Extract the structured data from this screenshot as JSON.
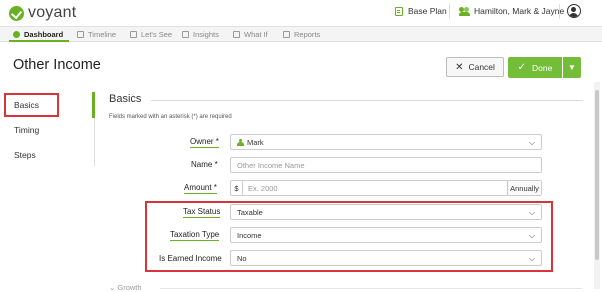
{
  "app": {
    "brand": "voyant"
  },
  "header": {
    "plan_label": "Base Plan",
    "household_label": "Hamilton, Mark & Jayne"
  },
  "nav": {
    "tabs": [
      {
        "label": "Dashboard",
        "active": true
      },
      {
        "label": "Timeline",
        "active": false
      },
      {
        "label": "Let's See",
        "active": false
      },
      {
        "label": "Insights",
        "active": false
      },
      {
        "label": "What If",
        "active": false
      },
      {
        "label": "Reports",
        "active": false
      }
    ]
  },
  "page": {
    "title": "Other Income",
    "cancel_label": "Cancel",
    "done_label": "Done"
  },
  "sidebar": {
    "items": [
      {
        "label": "Basics",
        "active": true
      },
      {
        "label": "Timing",
        "active": false
      },
      {
        "label": "Steps",
        "active": false
      }
    ]
  },
  "form": {
    "section_title": "Basics",
    "required_note": "Fields marked with an asterisk (*) are required",
    "owner": {
      "label": "Owner *",
      "value": "Mark"
    },
    "name": {
      "label": "Name *",
      "placeholder": "Other Income Name"
    },
    "amount": {
      "label": "Amount *",
      "currency": "$",
      "placeholder": "Ex. 2000",
      "frequency": "Annually"
    },
    "tax_status": {
      "label": "Tax Status",
      "value": "Taxable"
    },
    "taxation_type": {
      "label": "Taxation Type",
      "value": "Income"
    },
    "is_earned_income": {
      "label": "Is Earned Income",
      "value": "No"
    },
    "next_section": "Growth"
  },
  "colors": {
    "accent": "#6ab023",
    "done_button": "#74bd38",
    "highlight": "#d9343a"
  }
}
